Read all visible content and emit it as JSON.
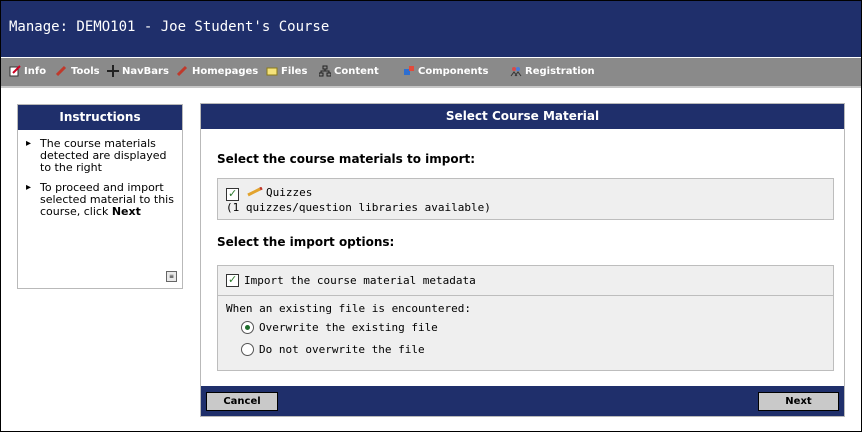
{
  "window": {
    "title": "Manage: DEMO101 - Joe Student's Course"
  },
  "toolbar": {
    "items": [
      {
        "label": "Info",
        "icon": "edit-icon"
      },
      {
        "label": "Tools",
        "icon": "tools-icon"
      },
      {
        "label": "NavBars",
        "icon": "navbars-icon"
      },
      {
        "label": "Homepages",
        "icon": "homepages-icon"
      },
      {
        "label": "Files",
        "icon": "folder-icon"
      },
      {
        "label": "Content",
        "icon": "content-icon"
      },
      {
        "label": "Components",
        "icon": "components-icon"
      },
      {
        "label": "Registration",
        "icon": "registration-icon"
      }
    ]
  },
  "instructions": {
    "title": "Instructions",
    "items": [
      {
        "text": "The course materials detected are displayed to the right"
      },
      {
        "text_prefix": "To proceed and import selected material to this course, click ",
        "text_bold": "Next"
      }
    ]
  },
  "main": {
    "title": "Select Course Material",
    "materials_heading": "Select the course materials to import:",
    "material": {
      "name": "Quizzes",
      "detail": "(1 quizzes/question libraries available)",
      "checked": true
    },
    "options_heading": "Select the import options:",
    "metadata_option": {
      "label": "Import the course material metadata",
      "checked": true
    },
    "existing_file_prompt": "When an existing file is encountered:",
    "radio_options": [
      {
        "label": "Overwrite the existing file",
        "selected": true
      },
      {
        "label": "Do not overwrite the file",
        "selected": false
      }
    ]
  },
  "footer": {
    "cancel_label": "Cancel",
    "next_label": "Next"
  },
  "colors": {
    "header_navy": "#1f2f6b",
    "toolbar_gray": "#8a8a8a",
    "panel_gray": "#efefef"
  }
}
